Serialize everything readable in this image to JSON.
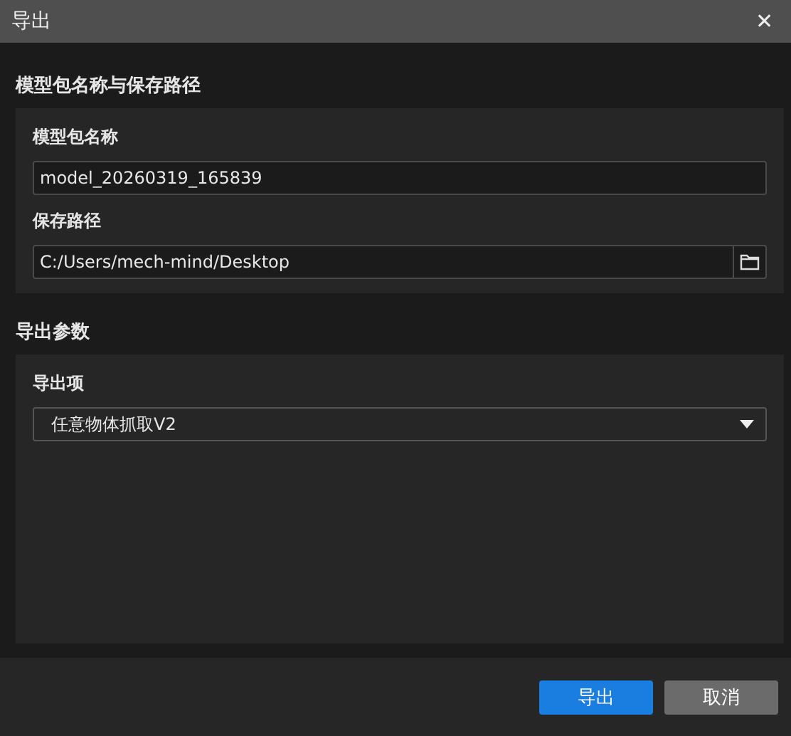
{
  "window": {
    "title": "导出",
    "close": "✕"
  },
  "sections": [
    {
      "title": "模型包名称与保存路径",
      "fields": [
        {
          "kind": "text",
          "label": "模型包名称",
          "value": "model_20260319_165839"
        },
        {
          "kind": "path",
          "label": "保存路径",
          "value": "C:/Users/mech-mind/Desktop"
        }
      ]
    },
    {
      "title": "导出参数",
      "fields": [
        {
          "kind": "select",
          "label": "导出项",
          "value": "任意物体抓取V2"
        }
      ]
    }
  ],
  "buttons": [
    {
      "label": "导出",
      "kind": "primary"
    },
    {
      "label": "取消",
      "kind": "secondary"
    }
  ]
}
